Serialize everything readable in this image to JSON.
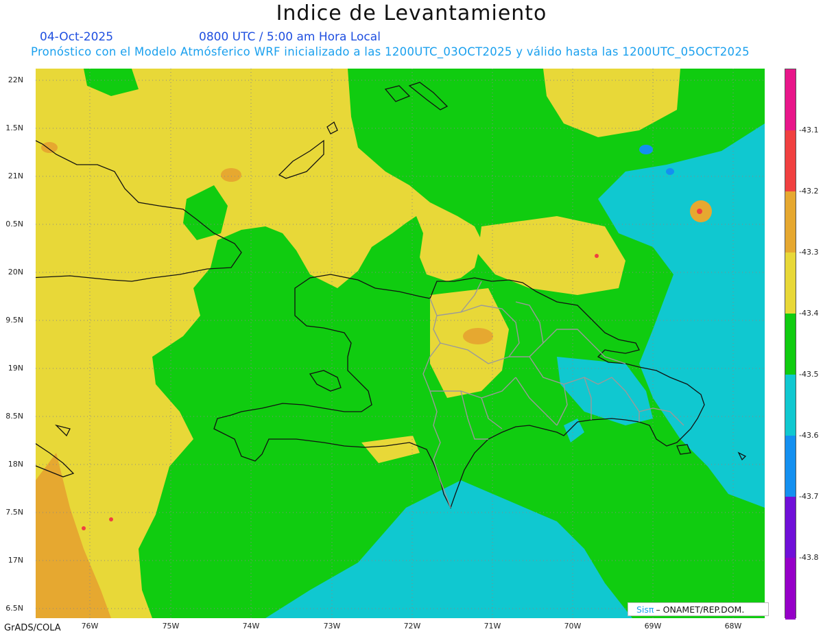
{
  "title": "Indice de Levantamiento",
  "date": "04-Oct-2025",
  "time": "0800 UTC / 5:00 am Hora Local",
  "forecast": "Pronóstico con el Modelo Atmósferico WRF inicializado a las 1200UTC_03OCT2025 y válido hasta las  1200UTC_05OCT2025",
  "credit": "GrADS/COLA",
  "logo": {
    "sis": "Sisπ",
    "text": "– ONAMET/REP.DOM."
  },
  "axes": {
    "lat_labels": [
      "22N",
      "1.5N",
      "21N",
      "0.5N",
      "20N",
      "9.5N",
      "19N",
      "8.5N",
      "18N",
      "7.5N",
      "17N",
      "6.5N"
    ],
    "lon_labels": [
      "76W",
      "75W",
      "74W",
      "73W",
      "72W",
      "71W",
      "70W",
      "69W",
      "68W"
    ]
  },
  "colorbar": {
    "colors": [
      "#e8168a",
      "#f04040",
      "#e6a830",
      "#e8d838",
      "#10cc10",
      "#10c8d0",
      "#1490f0",
      "#7010d8",
      "#9600c8"
    ],
    "labels": [
      "-43.1",
      "-43.2",
      "-43.3",
      "-43.4",
      "-43.5",
      "-43.6",
      "-43.7",
      "-43.8"
    ]
  },
  "colors": {
    "yellow": "#e8d838",
    "green": "#10cc10",
    "cyan": "#10c8d0",
    "orange": "#e6a830",
    "blue": "#1490f0",
    "red": "#f04040"
  }
}
